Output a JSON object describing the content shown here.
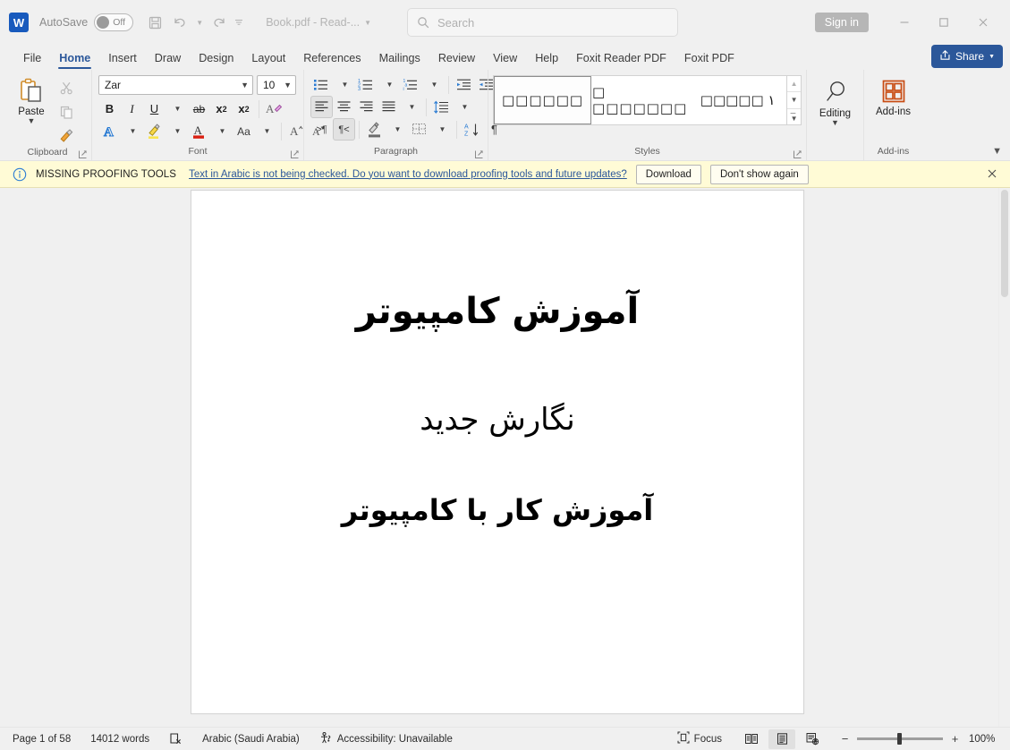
{
  "titlebar": {
    "logo": "W",
    "autosave_label": "AutoSave",
    "autosave_state": "Off",
    "save_icon": "save-icon",
    "undo_icon": "undo-icon",
    "redo_icon": "redo-icon",
    "customize_icon": "customize-quick-access-icon",
    "doc_title": "Book.pdf  -  Read-...",
    "signin_label": "Sign in",
    "minimize_icon": "minimize-icon",
    "maximize_icon": "maximize-icon",
    "close_icon": "close-icon"
  },
  "search": {
    "placeholder": "Search",
    "icon": "search-icon"
  },
  "tabs": [
    {
      "label": "File",
      "active": false
    },
    {
      "label": "Home",
      "active": true
    },
    {
      "label": "Insert",
      "active": false
    },
    {
      "label": "Draw",
      "active": false
    },
    {
      "label": "Design",
      "active": false
    },
    {
      "label": "Layout",
      "active": false
    },
    {
      "label": "References",
      "active": false
    },
    {
      "label": "Mailings",
      "active": false
    },
    {
      "label": "Review",
      "active": false
    },
    {
      "label": "View",
      "active": false
    },
    {
      "label": "Help",
      "active": false
    },
    {
      "label": "Foxit Reader PDF",
      "active": false
    },
    {
      "label": "Foxit PDF",
      "active": false
    }
  ],
  "share": {
    "label": "Share",
    "icon": "share-icon",
    "color": "#2b579a"
  },
  "ribbon": {
    "clipboard": {
      "group_label": "Clipboard",
      "paste_label": "Paste",
      "cut_icon": "scissors-icon",
      "copy_icon": "copy-icon",
      "format_painter_icon": "format-painter-icon"
    },
    "font": {
      "group_label": "Font",
      "font_name": "Zar",
      "font_size": "10",
      "bold_label": "B",
      "italic_label": "I",
      "underline_label": "U",
      "strikethrough_label": "ab",
      "subscript_label": "x",
      "superscript_label": "x",
      "clear_format_icon": "clear-formatting-icon",
      "text_effects_label": "A",
      "highlight_label": "highlight-icon",
      "font_color_label": "A",
      "change_case_label": "Aa",
      "grow_font_label": "A",
      "shrink_font_label": "A"
    },
    "paragraph": {
      "group_label": "Paragraph",
      "bullets_icon": "bullets-icon",
      "numbering_icon": "numbering-icon",
      "multilevel_icon": "multilevel-list-icon",
      "decrease_indent_icon": "decrease-indent-icon",
      "increase_indent_icon": "increase-indent-icon",
      "align_left_icon": "align-left-icon",
      "align_center_icon": "align-center-icon",
      "align_right_icon": "align-right-icon",
      "justify_icon": "justify-icon",
      "line_spacing_icon": "line-spacing-icon",
      "ltr_label": ">¶",
      "rtl_label": "¶<",
      "shading_icon": "shading-icon",
      "borders_icon": "borders-icon",
      "sort_label": "A Z",
      "show_marks_label": "¶"
    },
    "styles": {
      "group_label": "Styles",
      "items": [
        {
          "preview": "□□□□□□",
          "selected": true
        },
        {
          "preview": "□ □□□□□□□",
          "selected": false
        },
        {
          "preview": "□□□□□ ١",
          "selected": false
        }
      ],
      "scroll_up_icon": "scroll-up-icon",
      "scroll_down_icon": "scroll-down-icon",
      "more_styles_icon": "more-styles-icon"
    },
    "editing": {
      "group_label": "",
      "label": "Editing",
      "icon": "magnifier-icon"
    },
    "addins": {
      "group_label": "Add-ins",
      "label": "Add-ins",
      "icon": "addins-grid-icon",
      "color": "#c84b12"
    },
    "collapse_icon": "collapse-ribbon-icon"
  },
  "infobar": {
    "icon": "info-icon",
    "title": "MISSING PROOFING TOOLS",
    "message": "Text in Arabic is not being checked. Do you want to download proofing tools and future updates?",
    "download_label": "Download",
    "dismiss_label": "Don't show again",
    "close_icon": "close-icon"
  },
  "document": {
    "lines": [
      "آموزش کامپیوتر",
      "نگارش جدید",
      "آموزش کار با کامپیوتر"
    ]
  },
  "statusbar": {
    "page": "Page 1 of 58",
    "words": "14012 words",
    "proofing_icon": "proofing-errors-icon",
    "language": "Arabic (Saudi Arabia)",
    "accessibility_icon": "accessibility-icon",
    "accessibility": "Accessibility: Unavailable",
    "focus_label": "Focus",
    "focus_icon": "focus-icon",
    "read_mode_icon": "read-mode-icon",
    "print_layout_icon": "print-layout-icon",
    "web_layout_icon": "web-layout-icon",
    "zoom_out": "−",
    "zoom_in": "+",
    "zoom_level": "100%"
  }
}
